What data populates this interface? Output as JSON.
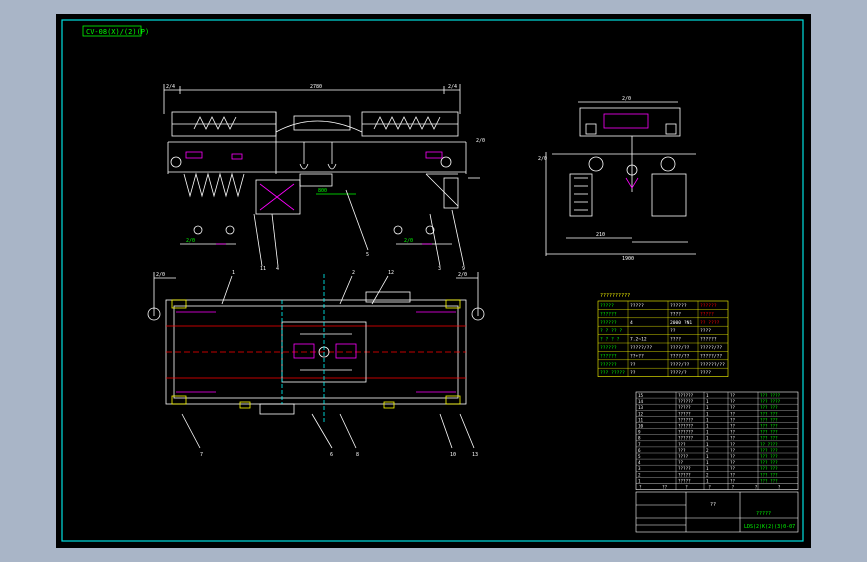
{
  "title_tag": "CV-08(X)/(2)(P)",
  "dimensions": {
    "main_span": "2780",
    "left_end": "2/4",
    "right_end": "2/4",
    "mid_small": "800",
    "left_wheel": "2/0",
    "right_wheel": "2/0",
    "right_height": "2/0",
    "side_top": "2/0",
    "side_mid": "210",
    "side_bottom": "1900",
    "side_small": "2/0",
    "plan_left": "2/0",
    "plan_right": "2/0"
  },
  "callouts": [
    "1",
    "2",
    "3",
    "4",
    "5",
    "6",
    "7",
    "8",
    "9",
    "10",
    "11",
    "12",
    "13"
  ],
  "spec_table": {
    "title": "??????????",
    "header": [
      "?????",
      "?????",
      "??????",
      "??????"
    ],
    "rows": [
      [
        "??????",
        "",
        "????",
        "?????"
      ],
      [
        "??????",
        "4",
        "2000 ?N1",
        "?? ????"
      ],
      [
        "? ? ?? ?",
        "",
        "??",
        "????"
      ],
      [
        "? ? ? ?",
        "7.2~12",
        "????",
        "??????"
      ],
      [
        "??????",
        "?????/??",
        "????/??",
        "?????/??"
      ],
      [
        "??????",
        "??+??",
        "????/??",
        "?????/??"
      ],
      [
        "??????",
        "??",
        "????/??",
        "??????/??"
      ],
      [
        "??? ?????",
        "??",
        "????/?",
        "????"
      ]
    ]
  },
  "parts_list": {
    "rows": [
      [
        "15",
        "??????",
        "1",
        "??",
        "??? ????"
      ],
      [
        "14",
        "??????",
        "1",
        "??",
        "??? ????"
      ],
      [
        "13",
        "?????",
        "1",
        "??",
        "??? ???"
      ],
      [
        "12",
        "?????",
        "1",
        "??",
        "??? ???"
      ],
      [
        "11",
        "??????",
        "1",
        "??",
        "??? ???"
      ],
      [
        "10",
        "??????",
        "1",
        "??",
        "??? ???"
      ],
      [
        "9",
        "??????",
        "1",
        "??",
        "??? ???"
      ],
      [
        "8",
        "??????",
        "1",
        "??",
        "??? ???"
      ],
      [
        "7",
        "???",
        "1",
        "??",
        "?? ????"
      ],
      [
        "6",
        "???",
        "2",
        "??",
        "??? ???"
      ],
      [
        "5",
        "????",
        "1",
        "??",
        "??? ???"
      ],
      [
        "4",
        "??",
        "1",
        "??",
        "??? ???"
      ],
      [
        "3",
        "?????",
        "1",
        "??",
        "??? ???"
      ],
      [
        "2",
        "?????",
        "2",
        "??",
        "??? ???"
      ],
      [
        "1",
        "?????",
        "1",
        "??",
        "??? ???"
      ]
    ],
    "footer": [
      "?",
      "??",
      "?",
      "?",
      "?",
      "?",
      "?"
    ]
  },
  "title_block": {
    "label": "??",
    "name": "?????",
    "drawing_no": "LDS(2)K(2)(3)0-07"
  },
  "colors": {
    "line": "#ffffff",
    "accent": "#ff00ff",
    "green": "#00ff00",
    "cyan": "#00ffff",
    "yellow": "#ffff00",
    "red": "#ff0000",
    "border": "#00e0e0",
    "bg": "#000000",
    "frame": "#a9b5c7"
  }
}
